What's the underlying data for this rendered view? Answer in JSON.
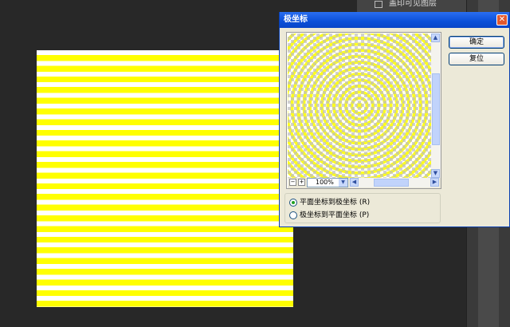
{
  "layers_panel": {
    "item_label": "盖印可见图层"
  },
  "dialog": {
    "title": "极坐标",
    "close_glyph": "✕",
    "ok_label": "确定",
    "reset_label": "复位",
    "zoom": {
      "value": "100%",
      "minus": "−",
      "plus": "+"
    },
    "options": [
      {
        "label": "平面坐标到极坐标 (R)",
        "selected": true
      },
      {
        "label": "极坐标到平面坐标 (P)",
        "selected": false
      }
    ]
  }
}
